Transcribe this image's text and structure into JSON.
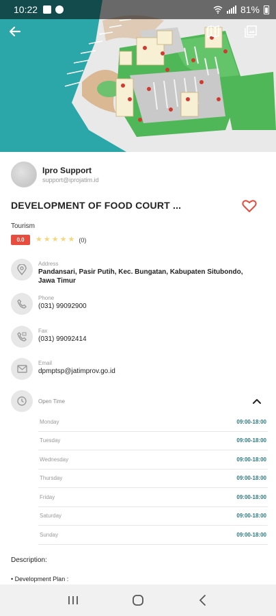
{
  "status_bar": {
    "time": "10:22",
    "battery": "81%"
  },
  "owner": {
    "name": "Ipro Support",
    "email": "support@iprojatim.id"
  },
  "listing": {
    "title": "DEVELOPMENT OF FOOD COURT ...",
    "category": "Tourism",
    "rating_score": "0.0",
    "rating_count": "(0)",
    "stars": 5
  },
  "address": {
    "label": "Address",
    "value": "Pandansari, Pasir Putih, Kec. Bungatan, Kabupaten Situbondo, Jawa Timur"
  },
  "phone": {
    "label": "Phone",
    "value": "(031) 99092900"
  },
  "fax": {
    "label": "Fax",
    "value": "(031) 99092414"
  },
  "email": {
    "label": "Email",
    "value": "dpmptsp@jatimprov.go.id"
  },
  "open_time": {
    "label": "Open Time",
    "days": [
      {
        "day": "Monday",
        "hours": "09:00-18:00"
      },
      {
        "day": "Tuesday",
        "hours": "09:00-18:00"
      },
      {
        "day": "Wednesday",
        "hours": "09:00-18:00"
      },
      {
        "day": "Thursday",
        "hours": "09:00-18:00"
      },
      {
        "day": "Friday",
        "hours": "09:00-18:00"
      },
      {
        "day": "Saturday",
        "hours": "09:00-18:00"
      },
      {
        "day": "Sunday",
        "hours": "09:00-18:00"
      }
    ]
  },
  "description": {
    "label": "Description:",
    "first_item": "• Development Plan :"
  },
  "colors": {
    "accent_red": "#e74c3c",
    "teal": "#2b7b83",
    "star": "#f5d67c"
  },
  "icons": [
    "back-arrow-icon",
    "map-icon",
    "gallery-icon",
    "heart-icon",
    "location-pin-icon",
    "phone-icon",
    "fax-icon",
    "email-icon",
    "clock-icon",
    "chevron-up-icon"
  ]
}
